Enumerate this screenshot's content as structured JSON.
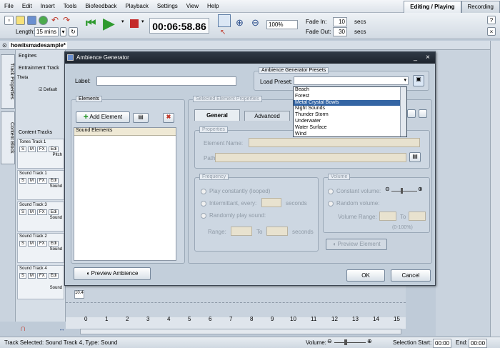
{
  "menu": [
    "File",
    "Edit",
    "Insert",
    "Tools",
    "Biofeedback",
    "Playback",
    "Settings",
    "View",
    "Help"
  ],
  "mode_tabs": [
    "Editing / Playing",
    "Recording"
  ],
  "toolbar": {
    "length_label": "Length:",
    "length_value": "15 mins",
    "timecode": "00:06:58.86",
    "zoom": "100%",
    "fade_in_label": "Fade In:",
    "fade_in_value": "10",
    "fade_out_label": "Fade Out:",
    "fade_out_value": "30",
    "secs": "secs"
  },
  "document_tab": "howitsmadesample*",
  "left_tabs": [
    "Track Properties",
    "Content Block"
  ],
  "panel": {
    "engines": "Engines",
    "entrainment": "Entrainment Track",
    "theta": "Theta",
    "default": "Default",
    "content_tracks": "Content Tracks",
    "pitch": "Pitch",
    "sound": "Sound"
  },
  "tracks": [
    {
      "name": "Tones Track 1"
    },
    {
      "name": "Sound Track 1"
    },
    {
      "name": "Sound Track 3"
    },
    {
      "name": "Sound Track 2"
    },
    {
      "name": "Sound Track 4"
    }
  ],
  "track_buttons": {
    "s": "S",
    "m": "M",
    "fx": "FX",
    "edit": "Edi"
  },
  "timeline": {
    "block_label": "10.4",
    "ticks": [
      "0",
      "1",
      "2",
      "3",
      "4",
      "5",
      "6",
      "7",
      "8",
      "9",
      "10",
      "11",
      "12",
      "13",
      "14",
      "15"
    ]
  },
  "status": {
    "text": "Track Selected: Sound Track 4, Type: Sound",
    "volume_label": "Volume:",
    "selection_start_label": "Selection Start:",
    "selection_start_value": "00:00",
    "end_label": "End:",
    "end_value": "00:00"
  },
  "dialog": {
    "title": "Ambience Generator",
    "label_caption": "Label:",
    "presets_title": "Ambience Generator Presets",
    "load_preset": "Load Preset:",
    "elements_title": "Elements",
    "add_element": "Add Element",
    "sound_elements": "Sound Elements",
    "selected_props_title": "Selected Element Properties",
    "tab_general": "General",
    "tab_advanced": "Advanced",
    "properties_title": "Properties",
    "element_name": "Element Name:",
    "path": "Path:",
    "frequency_title": "Frequency",
    "play_constantly": "Play constantly (looped)",
    "intermittent": "Intermittant, every:",
    "seconds": "seconds",
    "randomly": "Randomly play sound:",
    "range": "Range:",
    "to": "To",
    "volume_title": "Volume",
    "constant_volume": "Constant volume:",
    "random_volume": "Random volume:",
    "volume_range": "Volume Range:",
    "percent": "(0-100%)",
    "preview_element": "Preview Element",
    "preview_ambience": "Preview Ambience",
    "ok": "OK",
    "cancel": "Cancel"
  },
  "presets": [
    "Beach",
    "Forest",
    "Metal Crystal Bowls",
    "Night Sounds",
    "Thunder Storm",
    "Underwater",
    "Water Surface",
    "Wind"
  ],
  "presets_selected": "Metal Crystal Bowls",
  "colors": {
    "selection": "#3465a4",
    "title_bar": "#1d242d"
  }
}
